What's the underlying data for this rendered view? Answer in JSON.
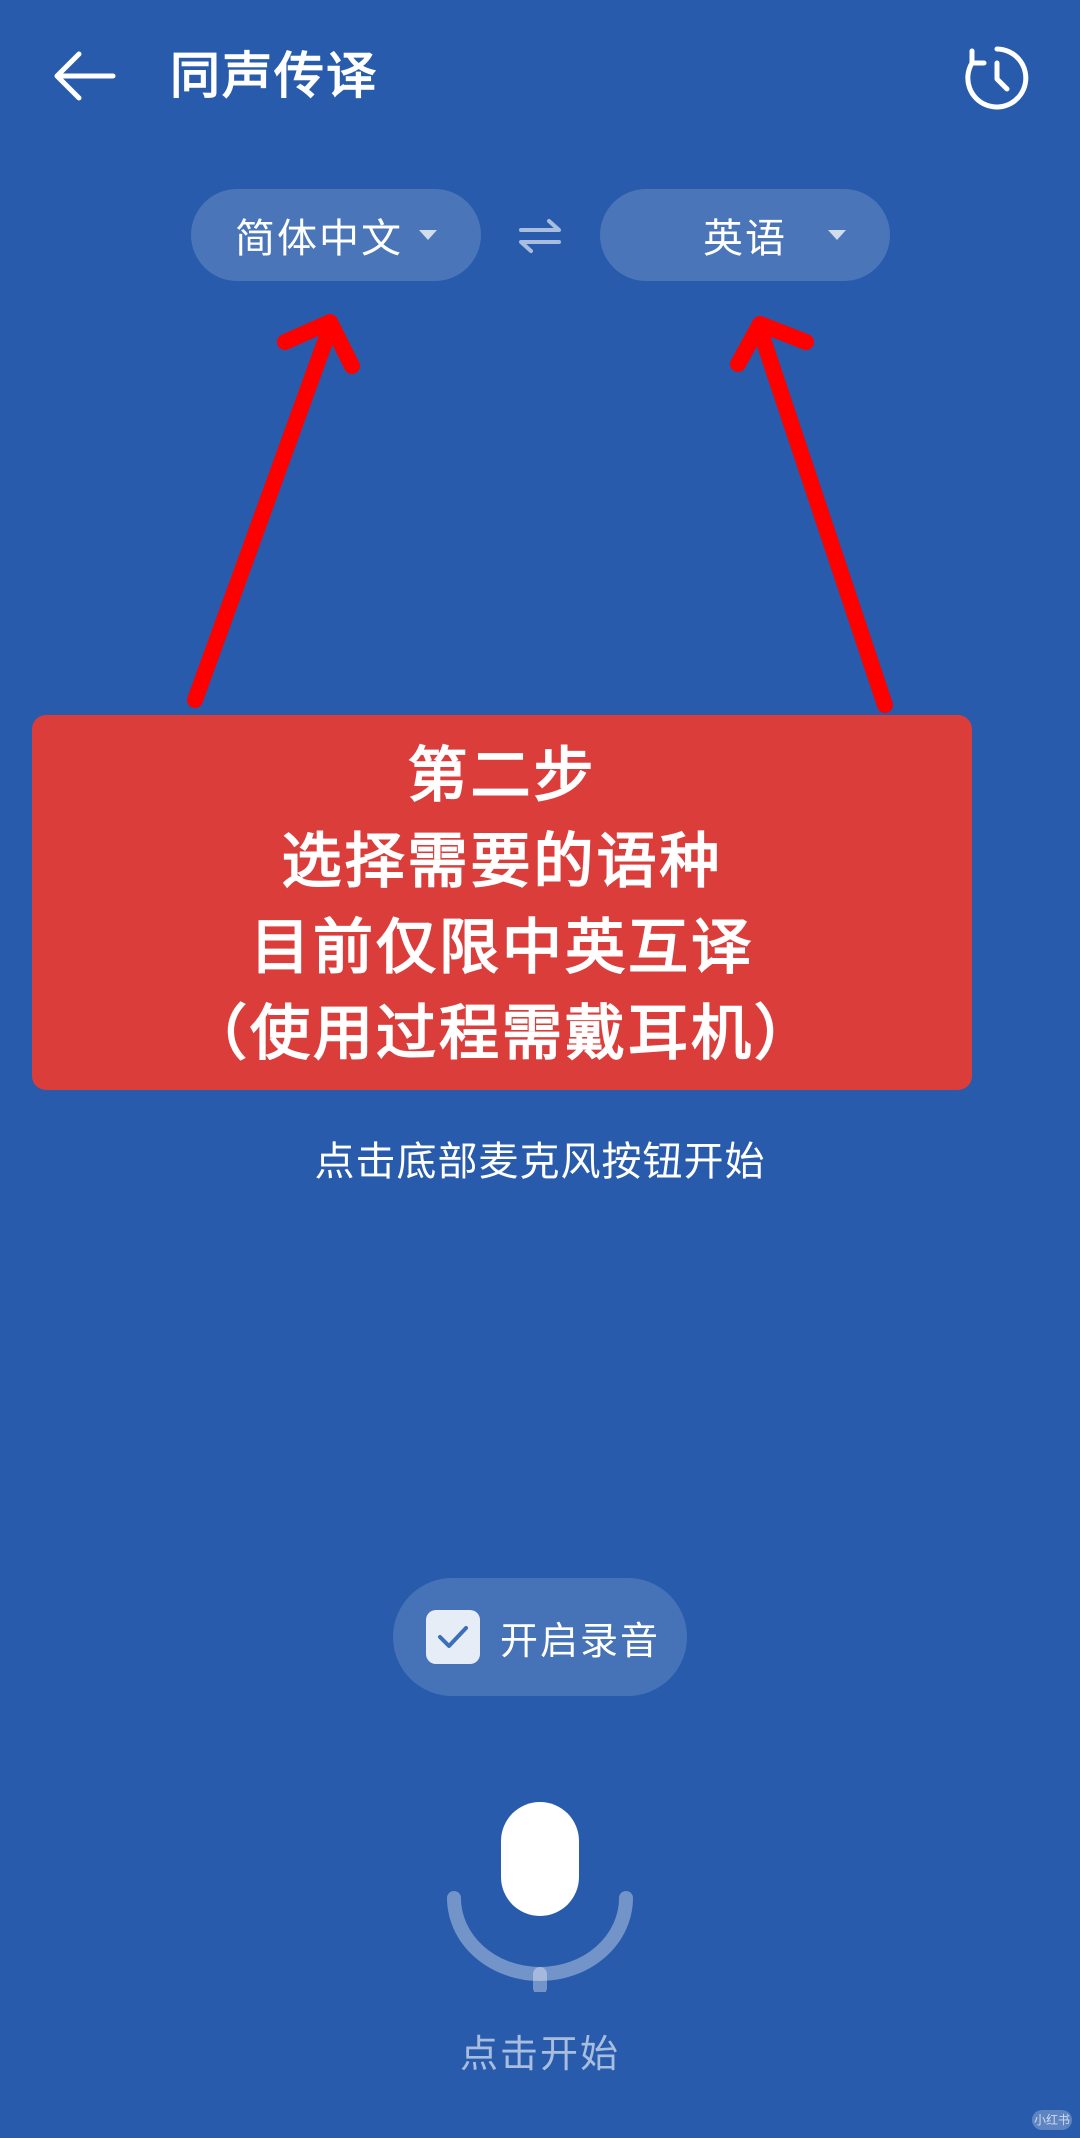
{
  "header": {
    "title": "同声传译",
    "back_icon": "arrow-left-icon",
    "history_icon": "history-clock-icon"
  },
  "languages": {
    "source": {
      "label": "简体中文"
    },
    "target": {
      "label": "英语"
    },
    "swap_icon": "swap-arrows-icon"
  },
  "annotation": {
    "lines": [
      "第二步",
      "选择需要的语种",
      "目前仅限中英互译",
      "（使用过程需戴耳机）"
    ],
    "box_color": "#db3d3b",
    "arrow_color": "#ff0000"
  },
  "hint": {
    "text": "点击底部麦克风按钮开始"
  },
  "record_toggle": {
    "label": "开启录音",
    "checked": true
  },
  "mic": {
    "icon": "microphone-icon",
    "label": "点击开始"
  },
  "watermark": {
    "text": "小红书"
  },
  "colors": {
    "background": "#285bac",
    "accent": "#ffffff"
  }
}
